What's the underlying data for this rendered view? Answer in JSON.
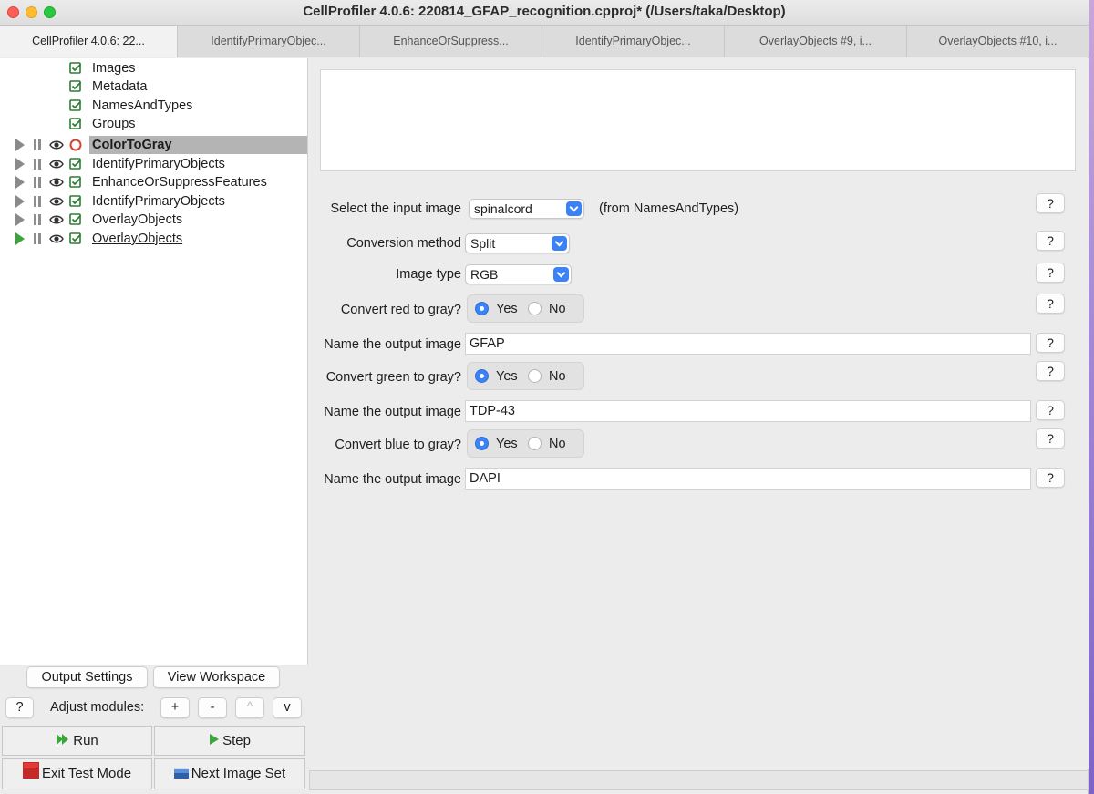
{
  "window": {
    "title": "CellProfiler 4.0.6: 220814_GFAP_recognition.cpproj* (/Users/taka/Desktop)"
  },
  "tabs": [
    {
      "label": "CellProfiler 4.0.6: 22..."
    },
    {
      "label": "IdentifyPrimaryObjec..."
    },
    {
      "label": "EnhanceOrSuppress..."
    },
    {
      "label": "IdentifyPrimaryObjec..."
    },
    {
      "label": "OverlayObjects #9, i..."
    },
    {
      "label": "OverlayObjects #10, i..."
    }
  ],
  "input_modules": [
    {
      "label": "Images"
    },
    {
      "label": "Metadata"
    },
    {
      "label": "NamesAndTypes"
    },
    {
      "label": "Groups"
    }
  ],
  "modules": [
    {
      "label": "ColorToGray",
      "status": "error",
      "selected": true
    },
    {
      "label": "IdentifyPrimaryObjects",
      "status": "ok"
    },
    {
      "label": "EnhanceOrSuppressFeatures",
      "status": "ok"
    },
    {
      "label": "IdentifyPrimaryObjects",
      "status": "ok"
    },
    {
      "label": "OverlayObjects",
      "status": "ok"
    },
    {
      "label": "OverlayObjects",
      "status": "ok",
      "current": true
    }
  ],
  "settings": {
    "input_image": {
      "label": "Select the input image",
      "value": "spinalcord",
      "from": "(from NamesAndTypes)"
    },
    "conversion": {
      "label": "Conversion method",
      "value": "Split"
    },
    "image_type": {
      "label": "Image type",
      "value": "RGB"
    },
    "red": {
      "label": "Convert red to gray?",
      "yes": "Yes",
      "no": "No",
      "selected": "Yes"
    },
    "red_name": {
      "label": "Name the output image",
      "value": "GFAP"
    },
    "green": {
      "label": "Convert green to gray?",
      "yes": "Yes",
      "no": "No",
      "selected": "Yes"
    },
    "green_name": {
      "label": "Name the output image",
      "value": "TDP-43"
    },
    "blue": {
      "label": "Convert blue to gray?",
      "yes": "Yes",
      "no": "No",
      "selected": "Yes"
    },
    "blue_name": {
      "label": "Name the output image",
      "value": "DAPI"
    },
    "help_label": "?"
  },
  "controls": {
    "output_settings": "Output Settings",
    "view_workspace": "View Workspace",
    "help": "?",
    "adjust_modules": "Adjust modules:",
    "add": "+",
    "remove": "-",
    "move_up": "^",
    "move_down": "v",
    "run": "Run",
    "step": "Step",
    "exit_test_mode": "Exit Test Mode",
    "next_image_set": "Next Image Set"
  },
  "colors": {
    "accent": "#3b82f6",
    "error": "#d9412f",
    "ok_check": "#2e7d32",
    "run_green": "#3aa63a"
  }
}
